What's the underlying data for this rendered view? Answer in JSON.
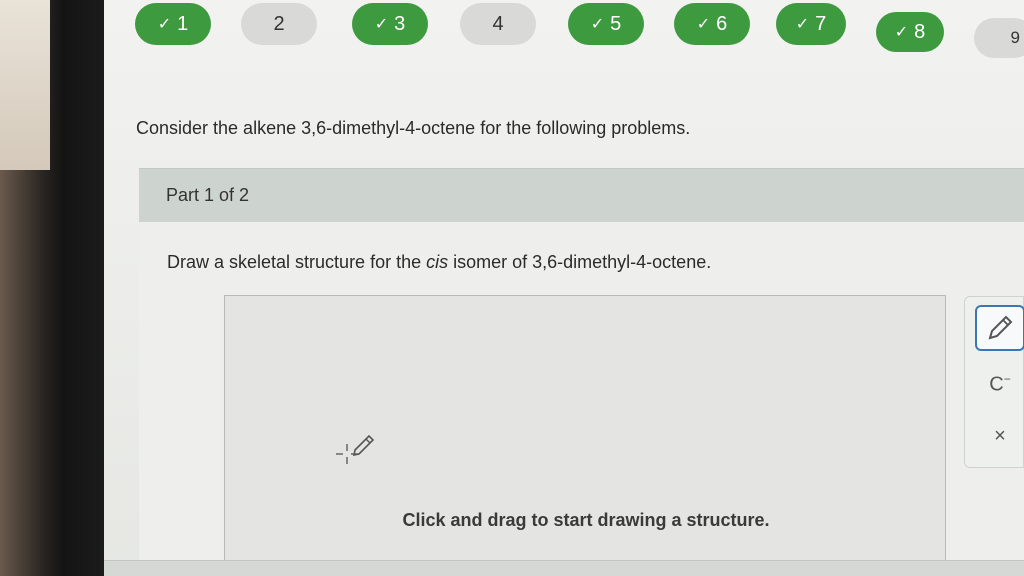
{
  "nav": {
    "items": [
      {
        "label": "1",
        "done": true
      },
      {
        "label": "2",
        "done": false
      },
      {
        "label": "3",
        "done": true
      },
      {
        "label": "4",
        "done": false
      },
      {
        "label": "5",
        "done": true
      },
      {
        "label": "6",
        "done": true
      },
      {
        "label": "7",
        "done": true
      },
      {
        "label": "8",
        "done": true
      },
      {
        "label": "9",
        "done": false
      }
    ],
    "done_icon": "check-icon",
    "colors": {
      "done": "#3e9a3f",
      "todo": "#d9dad8"
    }
  },
  "question": {
    "intro": "Consider the alkene 3,6-dimethyl-4-octene for the following problems."
  },
  "part": {
    "label": "Part 1 of 2",
    "prompt_before": "Draw a skeletal structure for the ",
    "prompt_emphasis": "cis",
    "prompt_after": " isomer of 3,6-dimethyl-4-octene."
  },
  "canvas": {
    "hint": "Click and drag to start drawing a structure.",
    "cursor_icon": "crosshair-pencil-icon"
  },
  "toolbar": {
    "pencil_icon": "pencil-icon",
    "charge_label": "C",
    "charge_sup": "−",
    "clear_label": "×",
    "accent": "#3a78b5"
  }
}
